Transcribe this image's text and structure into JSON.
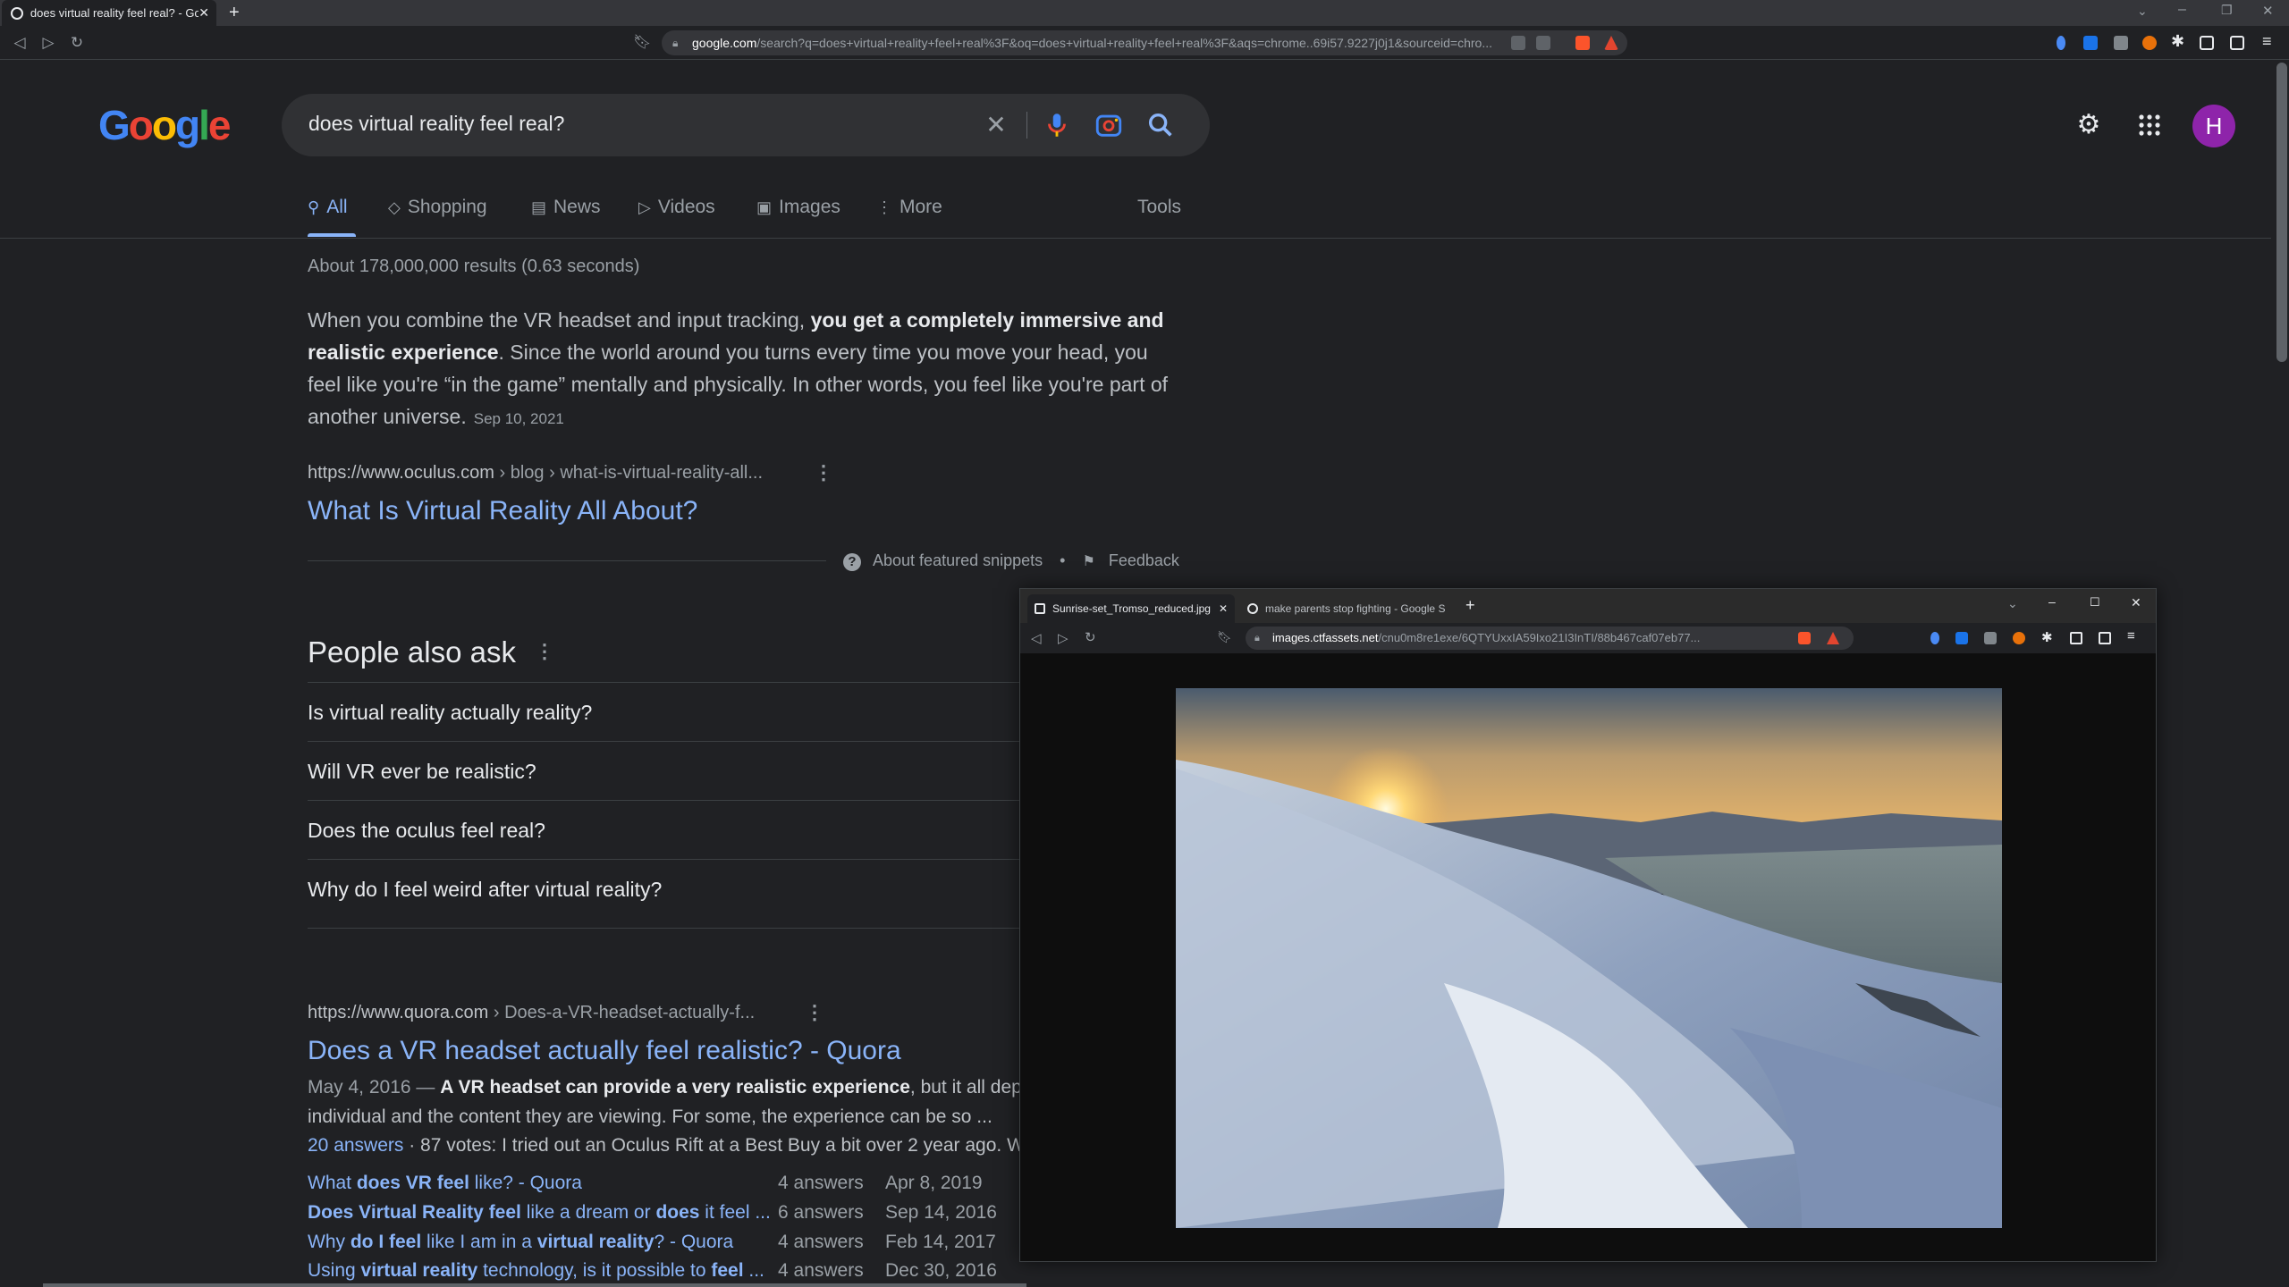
{
  "browser": {
    "tab_title": "does virtual reality feel real? - Go",
    "new_tab": "+",
    "url_host": "google.com",
    "url_rest": "/search?q=does+virtual+reality+feel+real%3F&oq=does+virtual+reality+feel+real%3F&aqs=chrome..69i57.9227j0j1&sourceid=chro..."
  },
  "google": {
    "logo": "Google",
    "query": "does virtual reality feel real?",
    "avatar_letter": "H",
    "tabs": [
      {
        "label": "All",
        "icon": "search-icon"
      },
      {
        "label": "Shopping",
        "icon": "tag-icon"
      },
      {
        "label": "News",
        "icon": "news-icon"
      },
      {
        "label": "Videos",
        "icon": "play-icon"
      },
      {
        "label": "Images",
        "icon": "image-icon"
      },
      {
        "label": "More",
        "icon": "more-vert-icon"
      }
    ],
    "tools": "Tools",
    "stats": "About 178,000,000 results (0.63 seconds)"
  },
  "snippet": {
    "text_before": "When you combine the VR headset and input tracking, ",
    "bold": "you get a completely immersive and realistic experience",
    "text_after": ". Since the world around you turns every time you move your head, you feel like you're “in the game” mentally and physically. In other words, you feel like you're part of another universe.",
    "date": "Sep 10, 2021",
    "cite_host": "https://www.oculus.com",
    "cite_path": " › blog › what-is-virtual-reality-all...",
    "title": "What Is Virtual Reality All About?",
    "about": "About featured snippets",
    "bullet": "•",
    "feedback": "Feedback"
  },
  "paa": {
    "title": "People also ask",
    "questions": [
      "Is virtual reality actually reality?",
      "Will VR ever be realistic?",
      "Does the oculus feel real?",
      "Why do I feel weird after virtual reality?"
    ]
  },
  "quora": {
    "cite_host": "https://www.quora.com",
    "cite_path": " › Does-a-VR-headset-actually-f...",
    "title": "Does a VR headset actually feel realistic? - Quora",
    "date": "May 4, 2016 — ",
    "bold1": "A VR headset can provide a very realistic experience",
    "text1": ", but it all depends on the",
    "line2": "individual and the content they are viewing. For some, the experience can be so ...",
    "answers_link": "20 answers",
    "line3": " · 87 votes: I tried out an Oculus Rift at a Best Buy a bit over 2 year ago. W",
    "subs": [
      {
        "pre": "What ",
        "b1": "does VR feel",
        "mid": " like? - Quora",
        "b2": "",
        "post": "",
        "answers": "4 answers",
        "date": "Apr 8, 2019"
      },
      {
        "pre": "",
        "b1": "Does Virtual Reality feel",
        "mid": " like a dream or ",
        "b2": "does",
        "post": " it feel ...",
        "answers": "6 answers",
        "date": "Sep 14, 2016"
      },
      {
        "pre": "Why ",
        "b1": "do I feel",
        "mid": " like I am in a ",
        "b2": "virtual reality",
        "post": "? - Quora",
        "answers": "4 answers",
        "date": "Feb 14, 2017"
      },
      {
        "pre": "Using ",
        "b1": "virtual reality",
        "mid": " technology, is it possible to ",
        "b2": "feel",
        "post": " ...",
        "answers": "4 answers",
        "date": "Dec 30, 2016"
      }
    ]
  },
  "window2": {
    "tab1": "Sunrise-set_Tromso_reduced.jpg",
    "tab2": "make parents stop fighting - Google S",
    "new_tab": "+",
    "url_host": "images.ctfassets.net",
    "url_rest": "/cnu0m8re1exe/6QTYUxxIA59Ixo21I3InTI/88b467caf07eb77...",
    "photo_alt": "Sunrise over snowy mountains near Tromso"
  },
  "colors": {
    "bg": "#202124",
    "link": "#8ab4f8",
    "avatar": "#8e24aa"
  }
}
